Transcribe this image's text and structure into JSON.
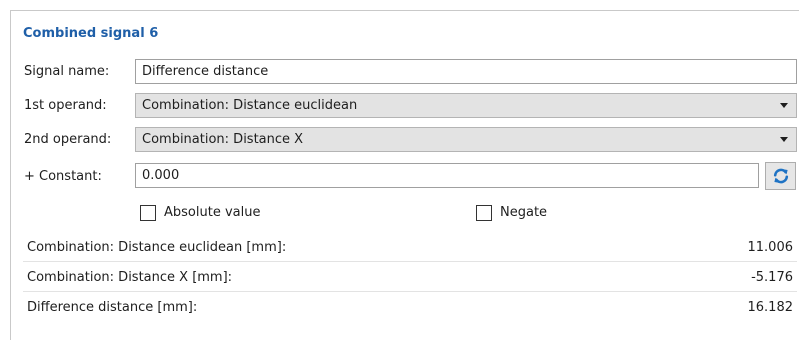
{
  "panel": {
    "title": "Combined signal 6"
  },
  "form": {
    "signal_name_label": "Signal name:",
    "signal_name_value": "Difference distance",
    "operand1_label": "1st operand:",
    "operand1_value": "Combination: Distance euclidean",
    "operand2_label": "2nd operand:",
    "operand2_value": "Combination: Distance X",
    "constant_label": "+ Constant:",
    "constant_value": "0.000",
    "absolute_label": "Absolute value",
    "absolute_checked": false,
    "negate_label": "Negate",
    "negate_checked": false
  },
  "results": [
    {
      "label": "Combination: Distance euclidean [mm]:",
      "value": "11.006"
    },
    {
      "label": "Combination: Distance X [mm]:",
      "value": "-5.176"
    },
    {
      "label": "Difference distance [mm]:",
      "value": "16.182"
    }
  ],
  "icons": {
    "refresh": "refresh-icon",
    "dropdown": "chevron-down-icon"
  },
  "colors": {
    "title": "#1f5fa8",
    "refresh_icon": "#1f73c4",
    "dropdown_bg": "#e3e3e3"
  }
}
